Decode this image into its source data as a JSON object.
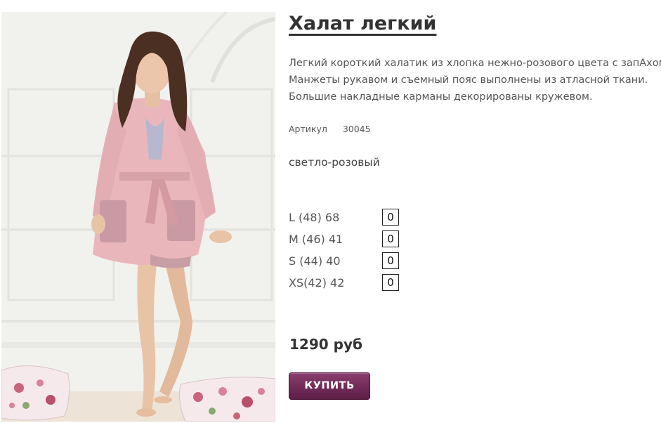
{
  "product": {
    "title": "Халат легкий",
    "image_alt": "photo-model-in-pink-robe",
    "description": [
      "Легкий короткий халатик из хлопка нежно-розового цвета с запАхом.",
      "Манжеты рукавом и съемный пояс выполнены из атласной ткани.",
      "Большие накладные карманы декорированы кружевом."
    ],
    "article_label": "Артикул",
    "article_value": "30045",
    "color": "светло-розовый",
    "sizes": [
      {
        "label": "L (48)  68",
        "qty": "0"
      },
      {
        "label": "M (46)  41",
        "qty": "0"
      },
      {
        "label": "S (44)  40",
        "qty": "0"
      },
      {
        "label": "XS(42)  42",
        "qty": "0"
      }
    ],
    "price": "1290 руб",
    "buy_label": "КУПИТЬ"
  },
  "colors": {
    "title": "#333333",
    "text": "#555555",
    "button_top": "#8a3d6e",
    "button_bottom": "#5c1e48",
    "robe": "#e8b4b8"
  }
}
